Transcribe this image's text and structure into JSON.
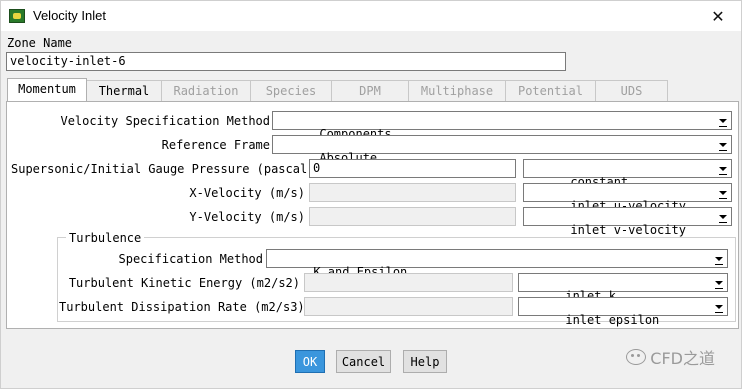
{
  "window": {
    "title": "Velocity Inlet",
    "close_glyph": "✕"
  },
  "zone": {
    "label": "Zone Name",
    "value": "velocity-inlet-6"
  },
  "tabs": [
    {
      "label": "Momentum",
      "state": "active"
    },
    {
      "label": "Thermal",
      "state": "enabled"
    },
    {
      "label": "Radiation",
      "state": "disabled"
    },
    {
      "label": "Species",
      "state": "disabled"
    },
    {
      "label": "DPM",
      "state": "disabled"
    },
    {
      "label": "Multiphase",
      "state": "disabled"
    },
    {
      "label": "Potential",
      "state": "disabled"
    },
    {
      "label": "UDS",
      "state": "disabled"
    }
  ],
  "momentum": {
    "velocity_spec_label": "Velocity Specification Method",
    "velocity_spec_value": "Components",
    "reference_frame_label": "Reference Frame",
    "reference_frame_value": "Absolute",
    "pressure_label": "Supersonic/Initial Gauge Pressure (pascal)",
    "pressure_value": "0",
    "pressure_profile": "constant",
    "x_velocity_label": "X-Velocity (m/s)",
    "x_velocity_value": "",
    "x_velocity_profile": "inlet u-velocity",
    "y_velocity_label": "Y-Velocity (m/s)",
    "y_velocity_value": "",
    "y_velocity_profile": "inlet v-velocity"
  },
  "turbulence": {
    "group_title": "Turbulence",
    "spec_method_label": "Specification Method",
    "spec_method_value": "K and Epsilon",
    "tke_label": "Turbulent Kinetic Energy (m2/s2)",
    "tke_value": "",
    "tke_profile": "inlet k",
    "tdr_label": "Turbulent Dissipation Rate (m2/s3)",
    "tdr_value": "",
    "tdr_profile": "inlet epsilon"
  },
  "buttons": {
    "ok": "OK",
    "cancel": "Cancel",
    "help": "Help"
  },
  "watermark": {
    "text": "CFD之道",
    "icon": "wechat-icon"
  },
  "colors": {
    "default_button": "#3a96dd",
    "app_icon_green": "#2a7a2a"
  }
}
